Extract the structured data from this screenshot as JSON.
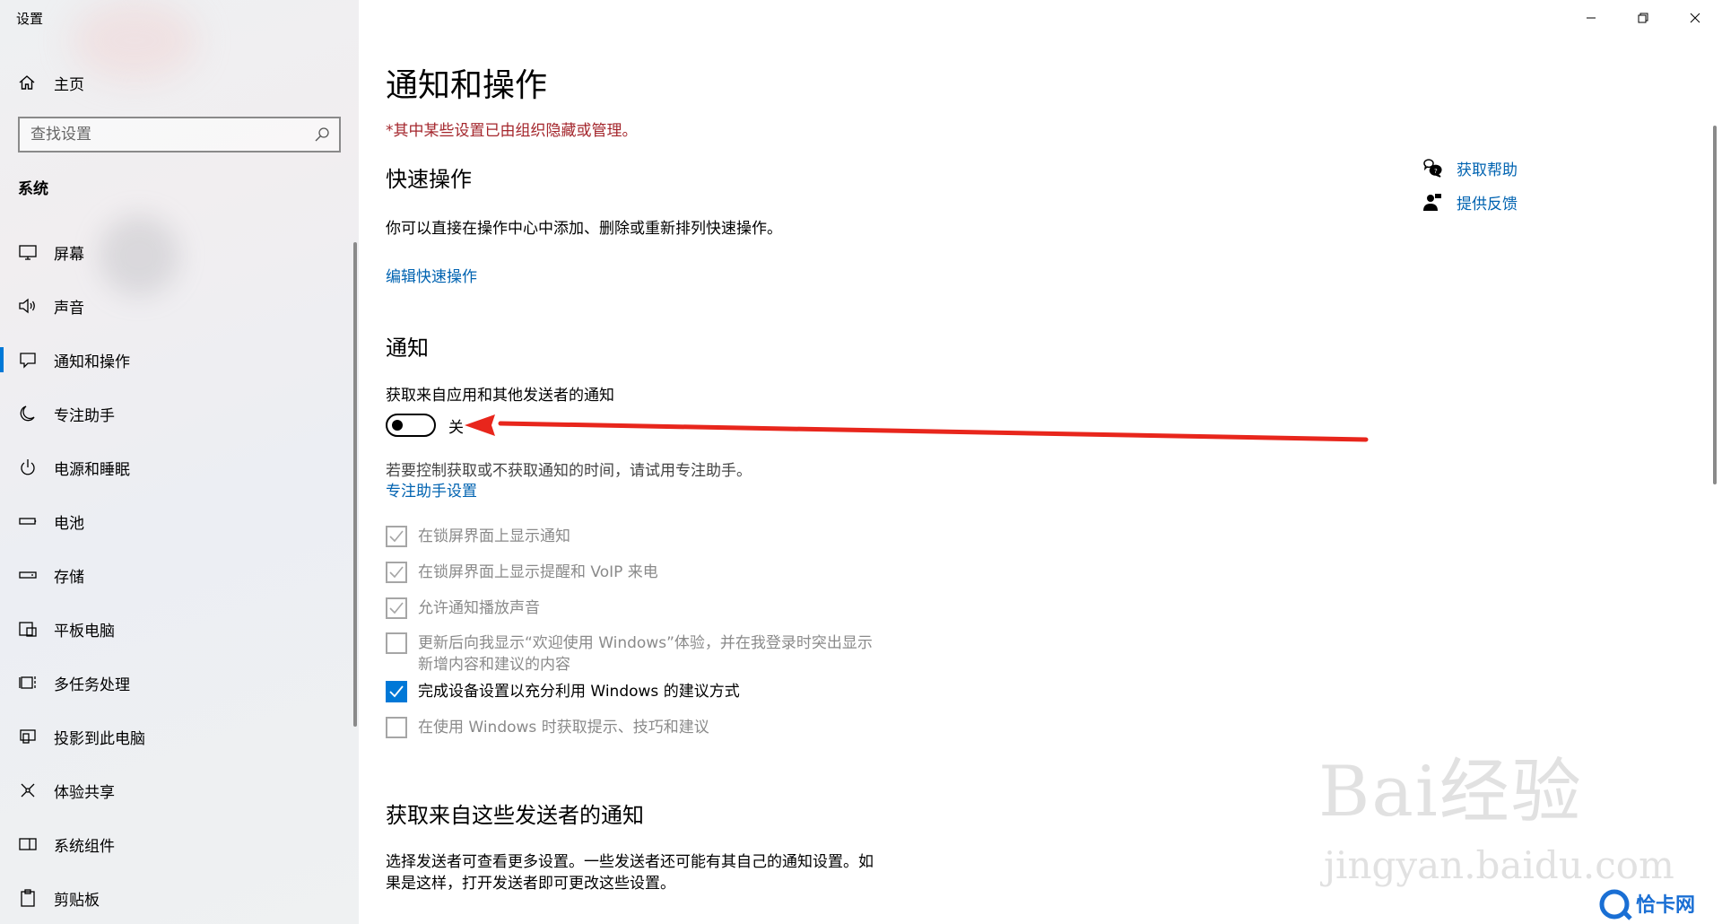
{
  "window": {
    "title": "设置",
    "controls": [
      "minimize",
      "restore",
      "close"
    ]
  },
  "sidebar": {
    "home_label": "主页",
    "search_placeholder": "查找设置",
    "section_label": "系统",
    "items": [
      {
        "label": "屏幕",
        "icon": "monitor-icon"
      },
      {
        "label": "声音",
        "icon": "speaker-icon"
      },
      {
        "label": "通知和操作",
        "icon": "notification-icon",
        "active": true
      },
      {
        "label": "专注助手",
        "icon": "moon-icon"
      },
      {
        "label": "电源和睡眠",
        "icon": "power-icon"
      },
      {
        "label": "电池",
        "icon": "battery-icon"
      },
      {
        "label": "存储",
        "icon": "storage-icon"
      },
      {
        "label": "平板电脑",
        "icon": "tablet-icon"
      },
      {
        "label": "多任务处理",
        "icon": "multitask-icon"
      },
      {
        "label": "投影到此电脑",
        "icon": "project-icon"
      },
      {
        "label": "体验共享",
        "icon": "share-icon"
      },
      {
        "label": "系统组件",
        "icon": "components-icon"
      },
      {
        "label": "剪贴板",
        "icon": "clipboard-icon"
      }
    ]
  },
  "main": {
    "title": "通知和操作",
    "managed_notice": "*其中某些设置已由组织隐藏或管理。",
    "quick_actions": {
      "heading": "快速操作",
      "description": "你可以直接在操作中心中添加、删除或重新排列快速操作。",
      "edit_link": "编辑快速操作"
    },
    "notifications": {
      "heading": "通知",
      "toggle_label": "获取来自应用和其他发送者的通知",
      "toggle_state": "关",
      "toggle_on": false,
      "focus_hint": "若要控制获取或不获取通知的时间，请试用专注助手。",
      "focus_link": "专注助手设置",
      "checkboxes": [
        {
          "label": "在锁屏界面上显示通知",
          "checked": true,
          "enabled": false
        },
        {
          "label": "在锁屏界面上显示提醒和 VoIP 来电",
          "checked": true,
          "enabled": false
        },
        {
          "label": "允许通知播放声音",
          "checked": true,
          "enabled": false
        },
        {
          "label_line1": "更新后向我显示“欢迎使用 Windows”体验，并在我登录时突出显示",
          "label_line2": "新增内容和建议的内容",
          "checked": false,
          "enabled": false
        },
        {
          "label": "完成设备设置以充分利用 Windows 的建议方式",
          "checked": true,
          "enabled": true
        },
        {
          "label": "在使用 Windows 时获取提示、技巧和建议",
          "checked": false,
          "enabled": false
        }
      ]
    },
    "senders": {
      "heading": "获取来自这些发送者的通知",
      "description_line1": "选择发送者可查看更多设置。一些发送者还可能有其自己的通知设置。如",
      "description_line2": "果是这样，打开发送者即可更改这些设置。"
    },
    "help_links": [
      {
        "label": "获取帮助",
        "icon": "help-chat-icon"
      },
      {
        "label": "提供反馈",
        "icon": "feedback-icon"
      }
    ]
  },
  "watermarks": {
    "baidu_logo": "Bai经验",
    "baidu_url": "jingyan.baidu.com",
    "site_logo": "恰卡网"
  },
  "colors": {
    "accent": "#0078d7",
    "link": "#0063b1",
    "warning": "#a4262c",
    "annotation_arrow": "#e8261c"
  }
}
